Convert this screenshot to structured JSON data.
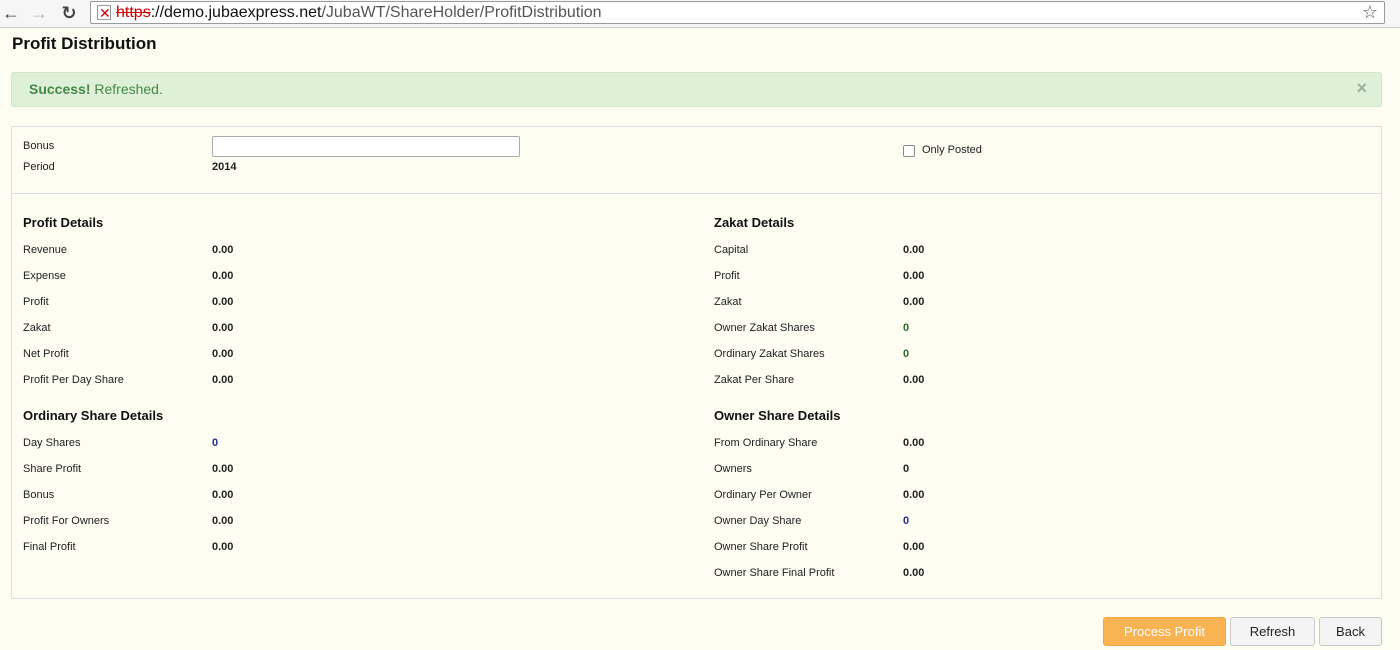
{
  "browser": {
    "url_scheme": "https",
    "url_host": "://demo.jubaexpress.net",
    "url_path": "/JubaWT/ShareHolder/ProfitDistribution",
    "back_icon": "←",
    "forward_icon": "→",
    "reload_icon": "↻",
    "star_icon": "☆",
    "error_icon": "✕"
  },
  "page": {
    "title": "Profit Distribution"
  },
  "alert": {
    "strong": "Success!",
    "message": " Refreshed.",
    "close": "×"
  },
  "filters": {
    "bonus_label": "Bonus",
    "bonus_value": "",
    "period_label": "Period",
    "period_value": "2014",
    "only_posted_label": "Only Posted"
  },
  "profit_details": {
    "title": "Profit Details",
    "rows": [
      {
        "label": "Revenue",
        "value": "0.00"
      },
      {
        "label": "Expense",
        "value": "0.00"
      },
      {
        "label": "Profit",
        "value": "0.00"
      },
      {
        "label": "Zakat",
        "value": "0.00"
      },
      {
        "label": "Net Profit",
        "value": "0.00"
      },
      {
        "label": "Profit Per Day Share",
        "value": "0.00"
      }
    ]
  },
  "zakat_details": {
    "title": "Zakat Details",
    "rows": [
      {
        "label": "Capital",
        "value": "0.00"
      },
      {
        "label": "Profit",
        "value": "0.00"
      },
      {
        "label": "Zakat",
        "value": "0.00"
      },
      {
        "label": "Owner Zakat Shares",
        "value": "0"
      },
      {
        "label": "Ordinary Zakat Shares",
        "value": "0"
      },
      {
        "label": "Zakat Per Share",
        "value": "0.00"
      }
    ]
  },
  "ordinary_share_details": {
    "title": "Ordinary Share Details",
    "rows": [
      {
        "label": "Day Shares",
        "value": "0"
      },
      {
        "label": "Share Profit",
        "value": "0.00"
      },
      {
        "label": "Bonus",
        "value": "0.00"
      },
      {
        "label": "Profit For Owners",
        "value": "0.00"
      },
      {
        "label": "Final Profit",
        "value": "0.00"
      }
    ]
  },
  "owner_share_details": {
    "title": "Owner Share Details",
    "rows": [
      {
        "label": "From Ordinary Share",
        "value": "0.00"
      },
      {
        "label": "Owners",
        "value": "0"
      },
      {
        "label": "Ordinary Per Owner",
        "value": "0.00"
      },
      {
        "label": "Owner Day Share",
        "value": "0"
      },
      {
        "label": "Owner Share Profit",
        "value": "0.00"
      },
      {
        "label": "Owner Share Final Profit",
        "value": "0.00"
      }
    ]
  },
  "actions": {
    "process_profit": "Process Profit",
    "refresh": "Refresh",
    "back": "Back"
  },
  "colors": {
    "page_bg": "#fdfdf2",
    "success_bg": "#dff0d8",
    "success_text": "#468847",
    "primary_button": "#f9b352",
    "link_value": "#1f2d8c"
  }
}
